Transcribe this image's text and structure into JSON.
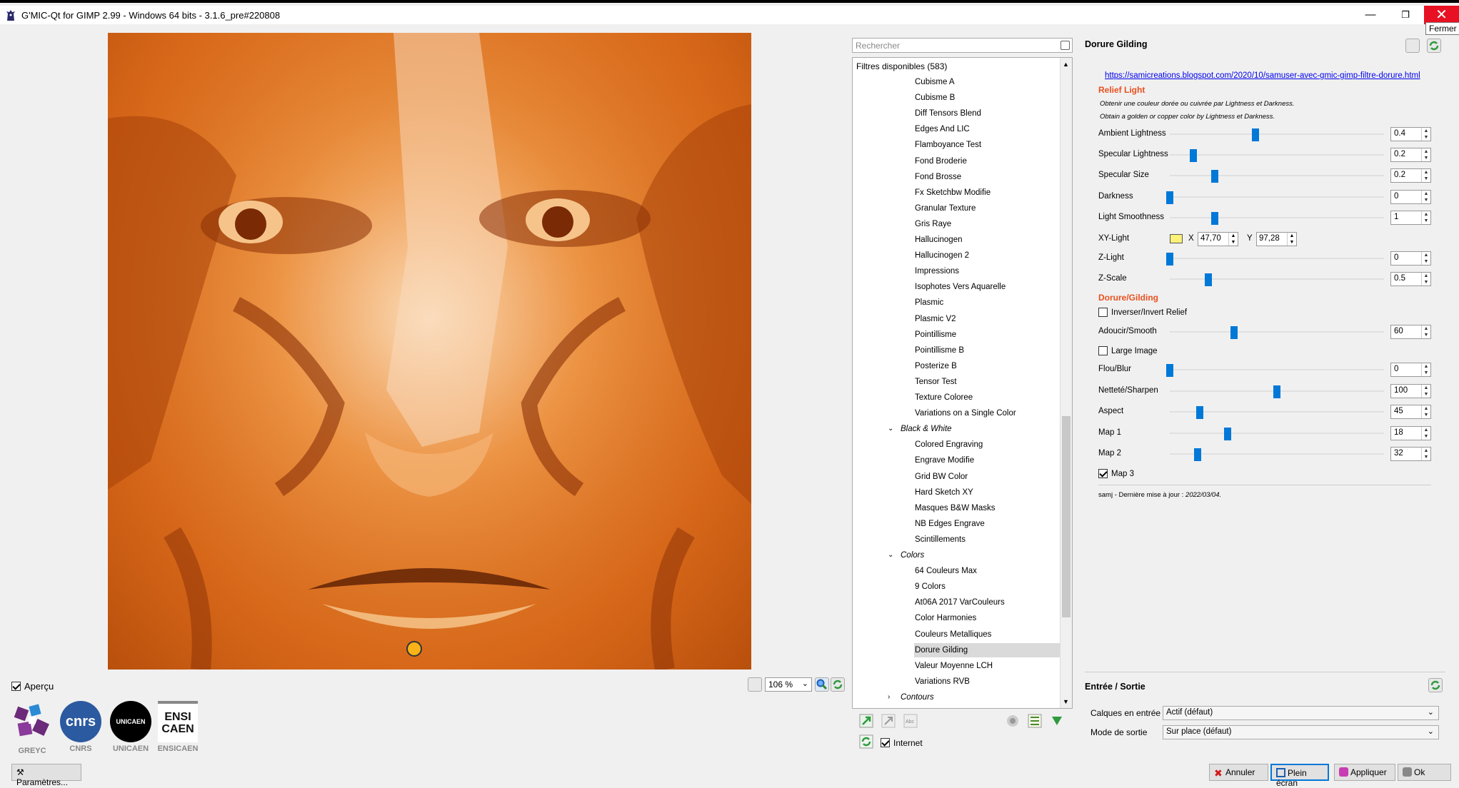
{
  "window": {
    "title": "G'MIC-Qt for GIMP 2.99 - Windows 64 bits - 3.1.6_pre#220808",
    "minimize": "—",
    "maximize": "❐",
    "close": "✕",
    "close_tooltip": "Fermer"
  },
  "preview": {
    "apercu_label": "Aperçu",
    "apercu_checked": true,
    "zoom": "106 %"
  },
  "logos": [
    {
      "caption": "GREYC",
      "mark": "",
      "color": "#6b2a7a"
    },
    {
      "caption": "CNRS",
      "mark": "cnrs",
      "color": "#2c5aa0"
    },
    {
      "caption": "UNICAEN",
      "mark": "UNICAEN",
      "color": "#000000"
    },
    {
      "caption": "ENSICAEN",
      "mark": "ENSI CAEN",
      "color": "#ffffff"
    }
  ],
  "parametres_button": "Paramètres...",
  "filters": {
    "search_placeholder": "Rechercher",
    "header": "Filtres disponibles (583)",
    "items": [
      {
        "label": "Cubisme A",
        "type": "item"
      },
      {
        "label": "Cubisme B",
        "type": "item"
      },
      {
        "label": "Diff Tensors Blend",
        "type": "item"
      },
      {
        "label": "Edges And LIC",
        "type": "item"
      },
      {
        "label": "Flamboyance Test",
        "type": "item"
      },
      {
        "label": "Fond Broderie",
        "type": "item"
      },
      {
        "label": "Fond Brosse",
        "type": "item"
      },
      {
        "label": "Fx Sketchbw Modifie",
        "type": "item"
      },
      {
        "label": "Granular Texture",
        "type": "item"
      },
      {
        "label": "Gris Raye",
        "type": "item"
      },
      {
        "label": "Hallucinogen",
        "type": "item"
      },
      {
        "label": "Hallucinogen 2",
        "type": "item"
      },
      {
        "label": "Impressions",
        "type": "item"
      },
      {
        "label": "Isophotes Vers Aquarelle",
        "type": "item"
      },
      {
        "label": "Plasmic",
        "type": "item"
      },
      {
        "label": "Plasmic V2",
        "type": "item"
      },
      {
        "label": "Pointillisme",
        "type": "item"
      },
      {
        "label": "Pointillisme B",
        "type": "item"
      },
      {
        "label": "Posterize B",
        "type": "item"
      },
      {
        "label": "Tensor Test",
        "type": "item"
      },
      {
        "label": "Texture Coloree",
        "type": "item"
      },
      {
        "label": "Variations on a Single Color",
        "type": "item"
      },
      {
        "label": "Black & White",
        "type": "cat-open"
      },
      {
        "label": "Colored Engraving",
        "type": "item"
      },
      {
        "label": "Engrave Modifie",
        "type": "item"
      },
      {
        "label": "Grid BW Color",
        "type": "item"
      },
      {
        "label": "Hard Sketch XY",
        "type": "item"
      },
      {
        "label": "Masques B&W Masks",
        "type": "item"
      },
      {
        "label": "NB Edges Engrave",
        "type": "item"
      },
      {
        "label": "Scintillements",
        "type": "item"
      },
      {
        "label": "Colors",
        "type": "cat-open"
      },
      {
        "label": "64 Couleurs Max",
        "type": "item"
      },
      {
        "label": "9 Colors",
        "type": "item"
      },
      {
        "label": "At06A 2017 VarCouleurs",
        "type": "item"
      },
      {
        "label": "Color Harmonies",
        "type": "item"
      },
      {
        "label": "Couleurs Metalliques",
        "type": "item"
      },
      {
        "label": "Dorure Gilding",
        "type": "item",
        "selected": true
      },
      {
        "label": "Valeur Moyenne LCH",
        "type": "item"
      },
      {
        "label": "Variations RVB",
        "type": "item"
      },
      {
        "label": "Contours",
        "type": "cat-closed"
      }
    ],
    "internet_label": "Internet",
    "internet_checked": true
  },
  "params": {
    "title": "Dorure Gilding",
    "link": "https://samicreations.blogspot.com/2020/10/samuser-avec-gmic-gimp-filtre-dorure.html",
    "section1": "Relief Light",
    "note_fr": "Obtenir une couleur dorée ou cuivrée par Lightness et Darkness.",
    "note_en": "Obtain a golden or copper color by Lightness et Darkness.",
    "sliders1": [
      {
        "label": "Ambient Lightness",
        "value": "0.4",
        "pos": 0.4
      },
      {
        "label": "Specular Lightness",
        "value": "0.2",
        "pos": 0.11
      },
      {
        "label": "Specular Size",
        "value": "0.2",
        "pos": 0.21
      },
      {
        "label": "Darkness",
        "value": "0",
        "pos": 0.0
      },
      {
        "label": "Light Smoothness",
        "value": "1",
        "pos": 0.21
      }
    ],
    "xy_light": {
      "label": "XY-Light",
      "x_label": "X",
      "x": "47,70",
      "y_label": "Y",
      "y": "97,28",
      "color": "#fff27a"
    },
    "sliders2": [
      {
        "label": "Z-Light",
        "value": "0",
        "pos": 0.0
      },
      {
        "label": "Z-Scale",
        "value": "0.5",
        "pos": 0.18
      }
    ],
    "section2": "Dorure/Gilding",
    "invert_label": "Inverser/Invert Relief",
    "invert_checked": false,
    "smooth": {
      "label": "Adoucir/Smooth",
      "value": "60",
      "pos": 0.3
    },
    "large_label": "Large Image",
    "large_checked": false,
    "sliders3": [
      {
        "label": "Flou/Blur",
        "value": "0",
        "pos": 0.0
      },
      {
        "label": "Netteté/Sharpen",
        "value": "100",
        "pos": 0.5
      },
      {
        "label": "Aspect",
        "value": "45",
        "pos": 0.14
      },
      {
        "label": "Map 1",
        "value": "18",
        "pos": 0.27
      },
      {
        "label": "Map 2",
        "value": "32",
        "pos": 0.13
      }
    ],
    "map3_label": "Map 3",
    "map3_checked": true,
    "footer": "samj - Dernière mise à jour : ",
    "footer_date": "2022/03/04."
  },
  "io": {
    "title": "Entrée / Sortie",
    "input_label": "Calques en entrée",
    "input_value": "Actif (défaut)",
    "output_label": "Mode de sortie",
    "output_value": "Sur place (défaut)"
  },
  "buttons": {
    "cancel": "Annuler",
    "fullscreen": "Plein écran",
    "apply": "Appliquer",
    "ok": "Ok"
  },
  "colors": {
    "accent": "#0078d7",
    "section": "#e8501e",
    "close_red": "#e81123"
  }
}
